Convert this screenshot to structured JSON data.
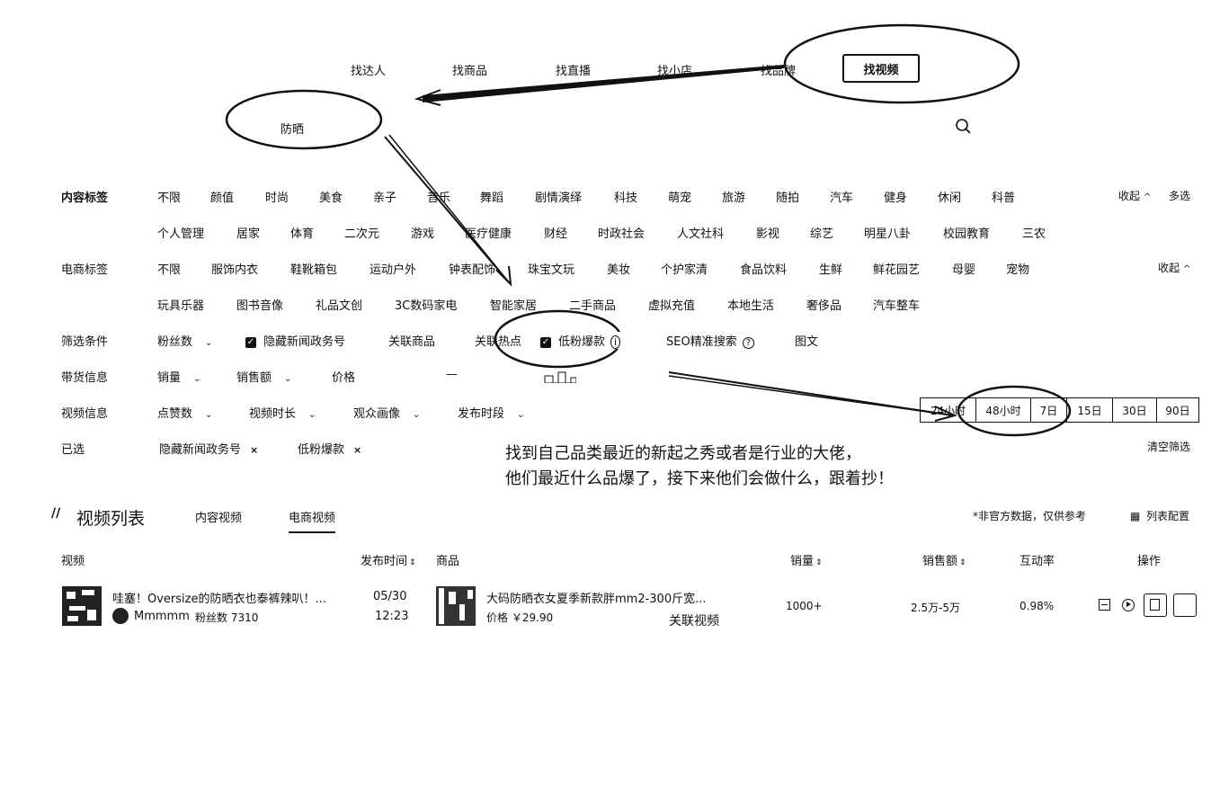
{
  "nav": {
    "items": [
      "找达人",
      "找商品",
      "找直播",
      "找小店",
      "找品牌"
    ],
    "active": "找视频",
    "search_value": "防晒"
  },
  "filters": {
    "content_tags": {
      "label": "内容标签",
      "row1": [
        "不限",
        "颜值",
        "时尚",
        "美食",
        "亲子",
        "音乐",
        "舞蹈",
        "剧情演绎",
        "科技",
        "萌宠",
        "旅游",
        "随拍",
        "汽车",
        "健身",
        "休闲",
        "科普"
      ],
      "row2": [
        "个人管理",
        "居家",
        "体育",
        "二次元",
        "游戏",
        "医疗健康",
        "财经",
        "时政社会",
        "人文社科",
        "影视",
        "综艺",
        "明星八卦",
        "校园教育",
        "三农"
      ],
      "collapse": "收起",
      "multi": "多选"
    },
    "ecom_tags": {
      "label": "电商标签",
      "row1": [
        "不限",
        "服饰内衣",
        "鞋靴箱包",
        "运动户外",
        "钟表配饰",
        "珠宝文玩",
        "美妆",
        "个护家清",
        "食品饮料",
        "生鲜",
        "鲜花园艺",
        "母婴",
        "宠物"
      ],
      "row2": [
        "玩具乐器",
        "图书音像",
        "礼品文创",
        "3C数码家电",
        "智能家居",
        "二手商品",
        "虚拟充值",
        "本地生活",
        "奢侈品",
        "汽车整车"
      ],
      "collapse": "收起"
    },
    "conditions": {
      "label": "筛选条件",
      "fans": "粉丝数",
      "hide_news": "隐藏新闻政务号",
      "related_goods": "关联商品",
      "related_hot": "关联热点",
      "low_fans": "低粉爆款",
      "seo": "SEO精准搜索",
      "graphic": "图文"
    },
    "goods_info": {
      "label": "带货信息",
      "sales": "销量",
      "revenue": "销售额",
      "price": "价格",
      "dash": "—"
    },
    "video_info": {
      "label": "视频信息",
      "likes": "点赞数",
      "duration": "视频时长",
      "audience": "观众画像",
      "publish_time": "发布时段",
      "time_ranges": [
        "24小时",
        "48小时",
        "7日",
        "15日",
        "30日",
        "90日"
      ]
    },
    "selected": {
      "label": "已选",
      "items": [
        "隐藏新闻政务号",
        "低粉爆款"
      ],
      "clear": "清空筛选"
    }
  },
  "annotation": {
    "line1": "找到自己品类最近的新起之秀或者是行业的大佬，",
    "line2": "他们最近什么品爆了，接下来他们会做什么，跟着抄！"
  },
  "list": {
    "title": "视频列表",
    "tabs": [
      "内容视频",
      "电商视频"
    ],
    "active_tab": "电商视频",
    "disclaimer": "*非官方数据，仅供参考",
    "config": "列表配置",
    "columns": [
      "视频",
      "发布时间",
      "商品",
      "销量",
      "销售额",
      "互动率",
      "操作"
    ],
    "rows": [
      {
        "video_title": "哇塞！Oversize的防晒衣也泰裤辣叭！...",
        "author": "Mmmmm",
        "fans": "粉丝数 7310",
        "date": "05/30",
        "time": "12:23",
        "product_title": "大码防晒衣女夏季新款胖mm2-300斤宽...",
        "price": "价格 ￥29.90",
        "related": "关联视频",
        "sales": "1000+",
        "revenue": "2.5万-5万",
        "engagement": "0.98%"
      }
    ]
  }
}
